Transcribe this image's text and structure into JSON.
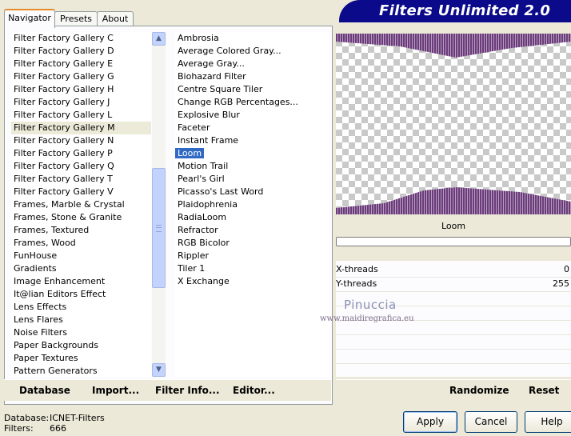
{
  "tabs": [
    "Navigator",
    "Presets",
    "About"
  ],
  "banner": {
    "title": "Filters Unlimited 2.0"
  },
  "categories": {
    "items": [
      "Filter Factory Gallery C",
      "Filter Factory Gallery D",
      "Filter Factory Gallery E",
      "Filter Factory Gallery G",
      "Filter Factory Gallery H",
      "Filter Factory Gallery J",
      "Filter Factory Gallery L",
      "Filter Factory Gallery M",
      "Filter Factory Gallery N",
      "Filter Factory Gallery P",
      "Filter Factory Gallery Q",
      "Filter Factory Gallery T",
      "Filter Factory Gallery V",
      "Frames, Marble & Crystal",
      "Frames, Stone & Granite",
      "Frames, Textured",
      "Frames, Wood",
      "FunHouse",
      "Gradients",
      "Image Enhancement",
      "It@lian Editors Effect",
      "Lens Effects",
      "Lens Flares",
      "Noise Filters",
      "Paper Backgrounds",
      "Paper Textures",
      "Pattern Generators"
    ],
    "selected": "Filter Factory Gallery M"
  },
  "filters": {
    "items": [
      "Ambrosia",
      "Average Colored Gray...",
      "Average Gray...",
      "Biohazard Filter",
      "Centre Square Tiler",
      "Change RGB Percentages...",
      "Explosive Blur",
      "Faceter",
      "Instant Frame",
      "Loom",
      "Motion Trail",
      "Pearl's Girl",
      "Picasso's Last Word",
      "Plaidophrenia",
      "RadiaLoom",
      "Refractor",
      "RGB Bicolor",
      "Rippler",
      "Tiler 1",
      "X Exchange"
    ],
    "selected": "Loom"
  },
  "preview": {
    "filter_name": "Loom"
  },
  "params": [
    {
      "label": "X-threads",
      "value": "0"
    },
    {
      "label": "Y-threads",
      "value": "255"
    }
  ],
  "watermark": {
    "name": "Pinuccia",
    "url": "www.maidiregrafica.eu"
  },
  "left_buttons": {
    "database": "Database",
    "import": "Import...",
    "filter_info": "Filter Info...",
    "editor": "Editor..."
  },
  "right_buttons": {
    "randomize": "Randomize",
    "reset": "Reset"
  },
  "status": {
    "database_label": "Database:",
    "database_value": "ICNET-Filters",
    "filters_label": "Filters:",
    "filters_value": "666"
  },
  "dialog_buttons": {
    "apply": "Apply",
    "cancel": "Cancel",
    "help": "Help"
  },
  "colors": {
    "accent": "#316ac5",
    "banner": "#0a0a8a",
    "loom": "#7a4a86"
  }
}
